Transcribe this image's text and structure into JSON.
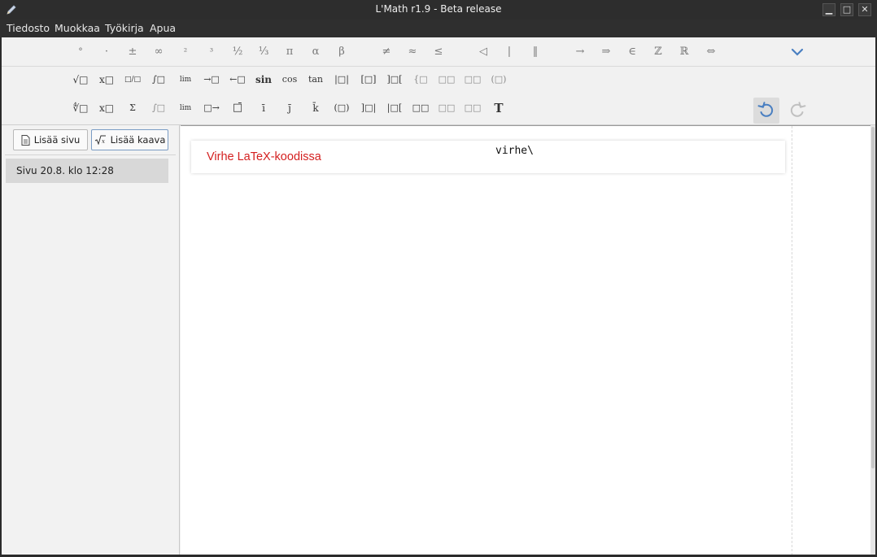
{
  "window": {
    "title": "L'Math r1.9 - Beta release",
    "min_glyph": "▁",
    "max_glyph": "□",
    "close_glyph": "✕"
  },
  "menu": {
    "items": [
      "Tiedosto",
      "Muokkaa",
      "Työkirja",
      "Apua"
    ]
  },
  "toolbar": {
    "row1": [
      "°",
      "·",
      "±",
      "∞",
      "²",
      "³",
      "½",
      "⅓",
      "π",
      "α",
      "β",
      "≠",
      "≈",
      "≤",
      "◁",
      "|",
      "‖",
      "→",
      "⇒",
      "∈",
      "ℤ",
      "ℝ",
      "⇔"
    ],
    "row2": [
      "√□",
      "x□",
      "□/□",
      "∫□",
      "lim",
      "→□",
      "←□",
      "sin",
      "cos",
      "tan",
      "|□|",
      "[□]",
      "]□[",
      "{□",
      "□□",
      "□□",
      "(□)"
    ],
    "row3": [
      "∜□",
      "x□",
      "Σ",
      "∫□",
      "lim",
      "□→",
      "□̄",
      "ī",
      "j̄",
      "k̄",
      "(□)",
      "]□|",
      "|□[",
      "□□",
      "□□",
      "□□",
      "T"
    ]
  },
  "icons": {
    "expand": "chevron-down-icon",
    "undo": "undo-icon",
    "redo": "redo-icon",
    "page": "document-icon",
    "formula": "sqrt-icon"
  },
  "sidebar": {
    "add_page_label": "Lisää sivu",
    "add_formula_label": "Lisää kaava",
    "pages": [
      {
        "label": "Sivu 20.8. klo 12:28"
      }
    ]
  },
  "document": {
    "error_message": "Virhe LaTeX-koodissa",
    "formula_source": "virhe\\"
  },
  "colors": {
    "accent": "#4a7fc1",
    "error": "#d42020"
  }
}
